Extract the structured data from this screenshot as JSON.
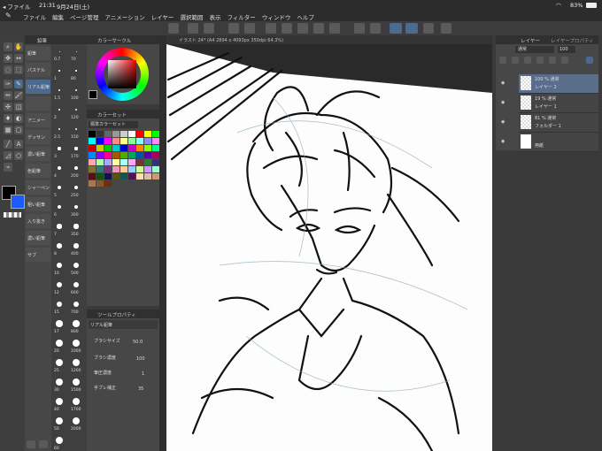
{
  "status_bar": {
    "app": "◂ ファイル",
    "time": "21:31",
    "date": "9月24日(土)",
    "battery": "83%"
  },
  "menu": [
    "ファイル",
    "編集",
    "ページ管理",
    "アニメーション",
    "レイヤー",
    "選択範囲",
    "表示",
    "フィルター",
    "ウィンドウ",
    "ヘルプ"
  ],
  "canvas_tab": "イラスト 24* (A4 2894 x 4093px 350dpi 64.3%)",
  "sub_tools": {
    "header": "鉛筆",
    "items": [
      "鉛筆",
      "パステル",
      "リアル鉛筆",
      "",
      "アニメ一",
      "デッサン",
      "濃い鉛筆",
      "色鉛筆",
      "シャーペン",
      "粗い鉛筆",
      "入り抜き",
      "濃い鉛筆",
      "サブ"
    ]
  },
  "brush_sizes": [
    "0.7",
    "1",
    "1.5",
    "2",
    "2.5",
    "3",
    "4",
    "5",
    "6",
    "7",
    "8",
    "10",
    "12",
    "15",
    "17",
    "20",
    "25",
    "30",
    "40",
    "50",
    "60",
    "70",
    "80",
    "100",
    "120",
    "150",
    "170",
    "200",
    "250",
    "300",
    "350",
    "400",
    "500",
    "600",
    "700",
    "800",
    "1000",
    "1200",
    "1500",
    "1700",
    "2000"
  ],
  "color_wheel": {
    "header": "カラーサークル",
    "accent": "#e8e8e8"
  },
  "color_set": {
    "header": "カラーセット",
    "name": "標準カラーセット"
  },
  "tool_property": {
    "header": "ツールプロパティ",
    "tool": "リアル鉛筆",
    "brush_size_label": "ブラシサイズ",
    "brush_size": "50.0",
    "opacity_label": "ブラシ濃度",
    "opacity": "100",
    "blend_label": "筆圧濃度",
    "blend": "1",
    "stab_label": "手ブレ補正",
    "stab": "35"
  },
  "layers": {
    "tab1": "レイヤー",
    "tab2": "レイヤープロパティ",
    "blend_mode": "通常",
    "opacity": "100",
    "rows": [
      {
        "pct": "100 % 通常",
        "name": "レイヤー 2"
      },
      {
        "pct": "19 % 通常",
        "name": "レイヤー 1"
      },
      {
        "pct": "81 % 通常",
        "name": "フォルダー 1"
      },
      {
        "pct": "",
        "name": "用紙"
      }
    ]
  },
  "colors": {
    "main": "#000000",
    "sub": "#1a5cff"
  }
}
